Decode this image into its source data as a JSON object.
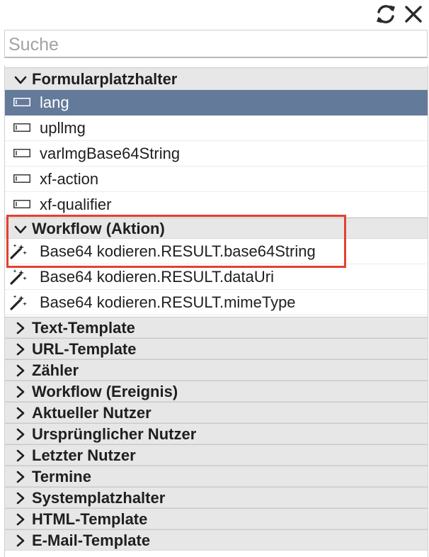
{
  "toolbar": {
    "refresh_icon": "refresh-icon",
    "close_icon": "close-icon"
  },
  "search": {
    "placeholder": "Suche",
    "value": ""
  },
  "groups": {
    "g0": {
      "label": "Formularplatzhalter",
      "expanded": true,
      "items": [
        "lang",
        "upllmg",
        "varlmgBase64String",
        "xf-action",
        "xf-qualifier"
      ],
      "icon": "input-field-icon"
    },
    "g1": {
      "label": "Workflow (Aktion)",
      "expanded": true,
      "items": [
        "Base64 kodieren.RESULT.base64String",
        "Base64 kodieren.RESULT.dataUri",
        "Base64 kodieren.RESULT.mimeType"
      ],
      "icon": "magic-wand-icon"
    },
    "g2": {
      "label": "Text-Template",
      "expanded": false
    },
    "g3": {
      "label": "URL-Template",
      "expanded": false
    },
    "g4": {
      "label": "Zähler",
      "expanded": false
    },
    "g5": {
      "label": "Workflow (Ereignis)",
      "expanded": false
    },
    "g6": {
      "label": "Aktueller Nutzer",
      "expanded": false
    },
    "g7": {
      "label": "Ursprünglicher Nutzer",
      "expanded": false
    },
    "g8": {
      "label": "Letzter Nutzer",
      "expanded": false
    },
    "g9": {
      "label": "Termine",
      "expanded": false
    },
    "g10": {
      "label": "Systemplatzhalter",
      "expanded": false
    },
    "g11": {
      "label": "HTML-Template",
      "expanded": false
    },
    "g12": {
      "label": "E-Mail-Template",
      "expanded": false
    }
  },
  "selected_item": "lang",
  "colors": {
    "selection": "#647a9a",
    "highlight_box": "#e2412f",
    "group_header": "#e7e7e7"
  }
}
